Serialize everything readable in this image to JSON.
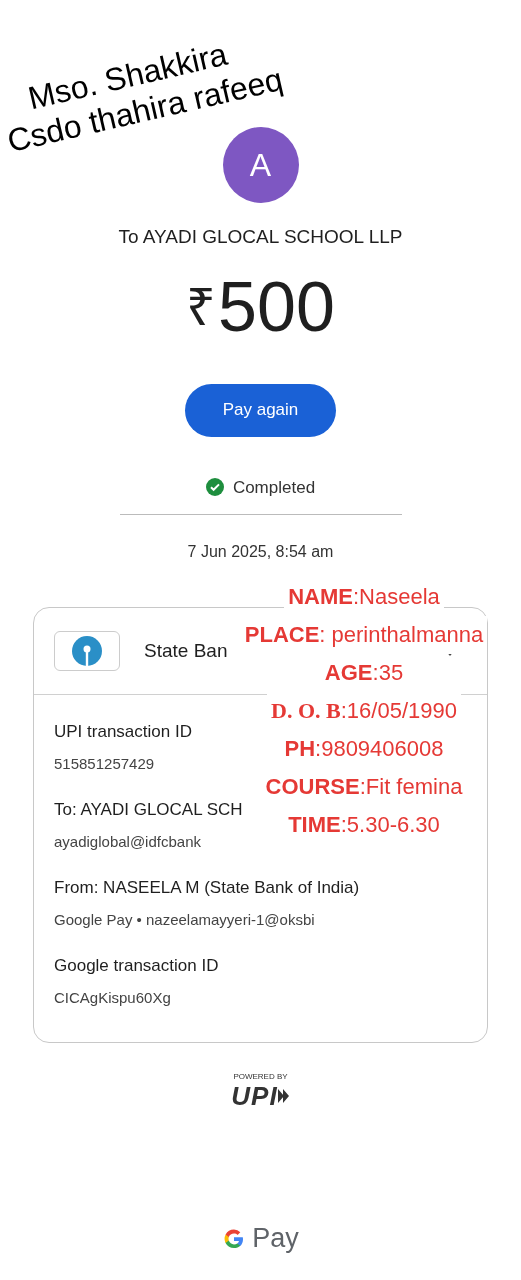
{
  "overlay_note": [
    "Mso. Shakkira",
    "Csdo thahira rafeeq"
  ],
  "payee": {
    "avatar_letter": "A",
    "title": "To AYADI GLOCAL SCHOOL LLP"
  },
  "amount": {
    "currency": "₹",
    "value": "500"
  },
  "pay_again_button": "Pay again",
  "status": {
    "label": "Completed",
    "completed": true
  },
  "timestamp": "7 Jun 2025, 8:54 am",
  "bank": {
    "name": "State Ban"
  },
  "details": [
    {
      "label": "UPI transaction ID",
      "value": "515851257429"
    },
    {
      "label": "To: AYADI GLOCAL SCH",
      "value": "ayadiglobal@idfcbank"
    },
    {
      "label": "From: NASEELA  M (State Bank of India)",
      "value": "Google Pay • nazeelamayyeri-1@oksbi"
    },
    {
      "label": "Google transaction ID",
      "value": "CICAgKispu60Xg"
    }
  ],
  "student_info": [
    {
      "key": "NAME",
      "value": ":Naseela"
    },
    {
      "key": "PLACE",
      "value": ": perinthalmanna"
    },
    {
      "key": "AGE",
      "value": ":35"
    },
    {
      "key": "D. O. B",
      "value": ":16/05/1990",
      "kind": "serif"
    },
    {
      "key": "PH",
      "value": ":9809406008"
    },
    {
      "key": "COURSE",
      "value": ":Fit femina"
    },
    {
      "key": "TIME",
      "value": ":5.30-6.30"
    }
  ],
  "footer": {
    "powered_by": "POWERED BY",
    "upi_logo": "UPI",
    "brand": "Pay"
  }
}
